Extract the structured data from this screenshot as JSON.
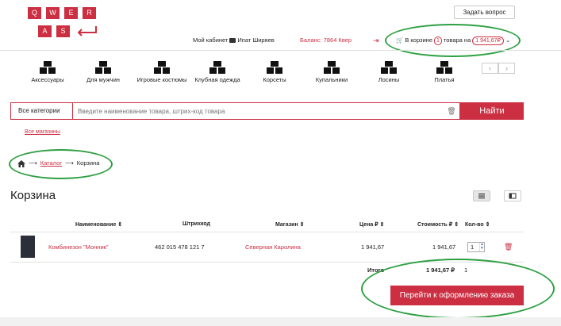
{
  "logo": {
    "letters": [
      "Q",
      "W",
      "E",
      "R",
      "A",
      "S"
    ]
  },
  "header": {
    "ask_button": "Задать вопрос",
    "cabinet_label": "Мой кабинет",
    "user_name": "Ипат Ширяев",
    "balance": "Баланс: 7864 Квер",
    "cart_prefix": "В корзине",
    "cart_count": "1",
    "cart_suffix": "товара на",
    "cart_total": "1 941,67₽"
  },
  "categories": [
    {
      "label": "Аксессуары"
    },
    {
      "label": "Для мужчин"
    },
    {
      "label": "Игровые костюмы"
    },
    {
      "label": "Клубная одежда"
    },
    {
      "label": "Корсеты"
    },
    {
      "label": "Купальники"
    },
    {
      "label": "Лосины"
    },
    {
      "label": "Платья"
    }
  ],
  "search": {
    "category": "Все категории",
    "placeholder": "Введите наименование товара, штрих-код товара",
    "button": "Найти"
  },
  "all_shops_link": "Все магазины",
  "breadcrumb": {
    "catalog": "Каталог",
    "current": "Корзина"
  },
  "page_title": "Корзина",
  "table": {
    "headers": {
      "name": "Наименование ⇕",
      "barcode": "Штрихкод",
      "shop": "Магазин ⇕",
      "price": "Цена ₽ ⇕",
      "cost": "Стоимость ₽ ⇕",
      "qty": "Кол-во ⇕"
    },
    "rows": [
      {
        "name": "Комбинезон \"Монник\"",
        "barcode": "462 015 478 121 7",
        "shop": "Северная Каролина",
        "price": "1 941,67",
        "cost": "1 941,67",
        "qty": "1"
      }
    ],
    "total_label": "Итого",
    "total_cost": "1 941,67 ₽",
    "total_qty": "1"
  },
  "checkout_button": "Перейти к оформлению заказа",
  "colors": {
    "accent": "#cc2f42",
    "annotation": "#2ea043"
  }
}
